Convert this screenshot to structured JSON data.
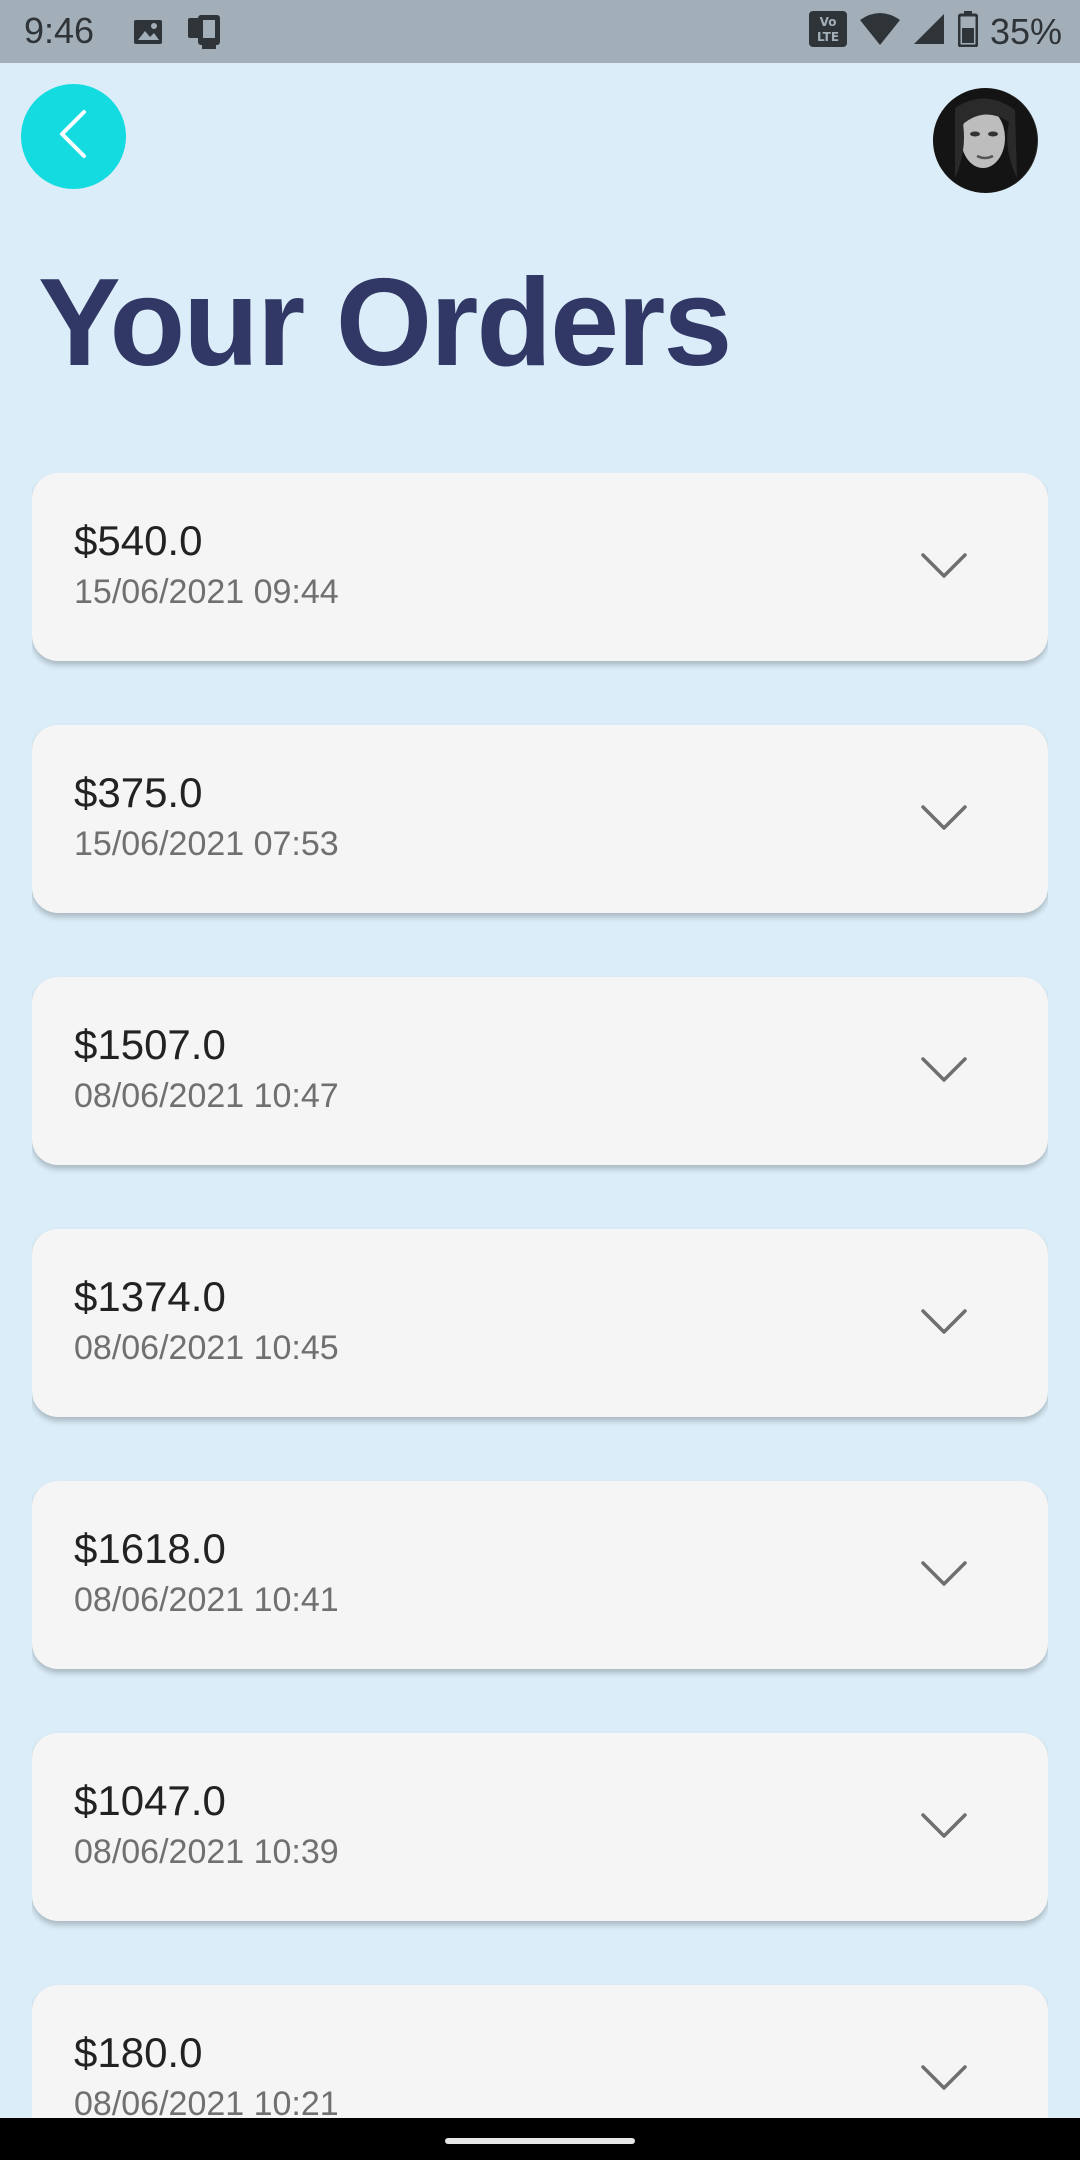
{
  "status_bar": {
    "time": "9:46",
    "battery": "35%",
    "icons": [
      "image-icon",
      "device-icon",
      "volte-icon",
      "wifi-icon",
      "signal-icon",
      "battery-icon"
    ]
  },
  "header": {
    "back_icon": "chevron-left-icon",
    "accent_color": "#14dbe0"
  },
  "page": {
    "title": "Your Orders"
  },
  "orders": [
    {
      "amount": "$540.0",
      "date": "15/06/2021 09:44"
    },
    {
      "amount": "$375.0",
      "date": "15/06/2021 07:53"
    },
    {
      "amount": "$1507.0",
      "date": "08/06/2021 10:47"
    },
    {
      "amount": "$1374.0",
      "date": "08/06/2021 10:45"
    },
    {
      "amount": "$1618.0",
      "date": "08/06/2021 10:41"
    },
    {
      "amount": "$1047.0",
      "date": "08/06/2021 10:39"
    },
    {
      "amount": "$180.0",
      "date": "08/06/2021 10:21"
    }
  ]
}
